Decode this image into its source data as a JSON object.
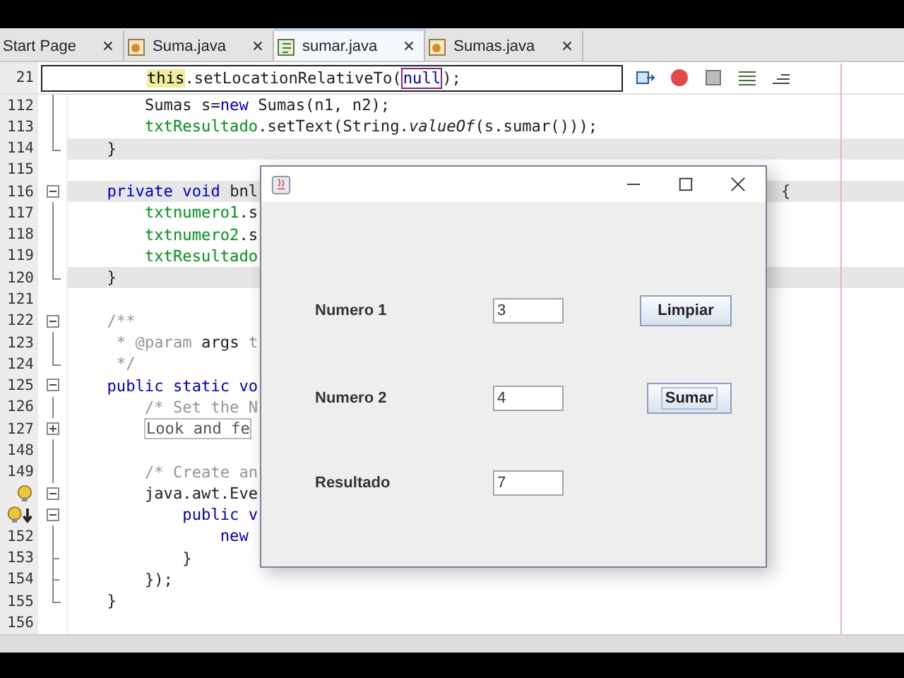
{
  "tabs": [
    {
      "label": "Start Page",
      "kind": "plain",
      "selected": false
    },
    {
      "label": "Suma.java",
      "kind": "java",
      "selected": false
    },
    {
      "label": "sumar.java",
      "kind": "form",
      "selected": true
    },
    {
      "label": "Sumas.java",
      "kind": "java",
      "selected": false
    }
  ],
  "sticky_line": {
    "number": "21",
    "tokens": [
      {
        "text": "this",
        "kind": "highlight"
      },
      {
        "text": ".setLocationRelativeTo(",
        "kind": "plain"
      },
      {
        "text": "null",
        "kind": "boxed"
      },
      {
        "text": ");",
        "kind": "plain"
      }
    ]
  },
  "lines": [
    {
      "number": "112",
      "kind": "body",
      "highlighted": false,
      "tokens": [
        {
          "text": "        Sumas s=",
          "kind": "plain"
        },
        {
          "text": "new",
          "kind": "keyword"
        },
        {
          "text": " Sumas(n1, n2);",
          "kind": "plain"
        }
      ]
    },
    {
      "number": "113",
      "kind": "body",
      "highlighted": false,
      "tokens": [
        {
          "text": "        txtResultado",
          "kind": "field"
        },
        {
          "text": ".setText(String.",
          "kind": "plain"
        },
        {
          "text": "valueOf",
          "kind": "italic"
        },
        {
          "text": "(s.sumar()));",
          "kind": "plain"
        }
      ]
    },
    {
      "number": "114",
      "kind": "end",
      "highlighted": true,
      "tokens": [
        {
          "text": "    }",
          "kind": "plain"
        }
      ]
    },
    {
      "number": "115",
      "kind": "plain",
      "highlighted": false
    },
    {
      "number": "116",
      "kind": "start",
      "highlighted": true,
      "tokens": [
        {
          "text": "    private void",
          "kind": "keyword"
        },
        {
          "text": " bnl",
          "kind": "plain"
        }
      ],
      "tail": "{"
    },
    {
      "number": "117",
      "kind": "body",
      "highlighted": false,
      "tokens": [
        {
          "text": "        txtnumero1",
          "kind": "field"
        },
        {
          "text": ".s",
          "kind": "plain"
        }
      ]
    },
    {
      "number": "118",
      "kind": "body",
      "highlighted": false,
      "tokens": [
        {
          "text": "        txtnumero2",
          "kind": "field"
        },
        {
          "text": ".s",
          "kind": "plain"
        }
      ]
    },
    {
      "number": "119",
      "kind": "body",
      "highlighted": false,
      "tokens": [
        {
          "text": "        txtResultado",
          "kind": "field"
        }
      ]
    },
    {
      "number": "120",
      "kind": "end",
      "highlighted": true,
      "tokens": [
        {
          "text": "    }",
          "kind": "plain"
        }
      ]
    },
    {
      "number": "121",
      "kind": "plain",
      "highlighted": false
    },
    {
      "number": "122",
      "kind": "start",
      "highlighted": false,
      "tokens": [
        {
          "text": "    /**",
          "kind": "comment"
        }
      ]
    },
    {
      "number": "123",
      "kind": "body",
      "highlighted": false,
      "tokens": [
        {
          "text": "     * @param ",
          "kind": "comment"
        },
        {
          "text": "args",
          "kind": "plain"
        },
        {
          "text": " t",
          "kind": "comment"
        }
      ]
    },
    {
      "number": "124",
      "kind": "end",
      "highlighted": false,
      "tokens": [
        {
          "text": "     */",
          "kind": "comment"
        }
      ]
    },
    {
      "number": "125",
      "kind": "start",
      "highlighted": false,
      "tokens": [
        {
          "text": "    public static vo",
          "kind": "keyword"
        }
      ]
    },
    {
      "number": "126",
      "kind": "body",
      "highlighted": false,
      "tokens": [
        {
          "text": "        /* Set the N",
          "kind": "comment"
        }
      ]
    },
    {
      "number": "127",
      "kind": "collapsed",
      "highlighted": false,
      "tokens": [
        {
          "text": "        Look and fe",
          "kind": "folded"
        }
      ]
    },
    {
      "number": "148",
      "kind": "body",
      "highlighted": false
    },
    {
      "number": "149",
      "kind": "body",
      "highlighted": false,
      "tokens": [
        {
          "text": "        /* Create an",
          "kind": "comment"
        }
      ]
    },
    {
      "kind": "bulb",
      "highlighted": false,
      "tokens": [
        {
          "text": "        java.awt.Eve",
          "kind": "plain"
        }
      ]
    },
    {
      "kind": "bulb-arrow",
      "highlighted": false,
      "tokens": [
        {
          "text": "            public v",
          "kind": "keyword"
        }
      ]
    },
    {
      "number": "152",
      "kind": "body",
      "highlighted": false,
      "tokens": [
        {
          "text": "                new",
          "kind": "keyword"
        }
      ]
    },
    {
      "number": "153",
      "kind": "tick",
      "highlighted": false,
      "tokens": [
        {
          "text": "            }",
          "kind": "plain"
        }
      ]
    },
    {
      "number": "154",
      "kind": "tick",
      "highlighted": false,
      "tokens": [
        {
          "text": "        });",
          "kind": "plain"
        }
      ]
    },
    {
      "number": "155",
      "kind": "end",
      "highlighted": false,
      "tokens": [
        {
          "text": "    }",
          "kind": "plain"
        }
      ]
    },
    {
      "number": "156",
      "kind": "plain",
      "highlighted": false
    }
  ],
  "dialog": {
    "rows": [
      {
        "label": "Numero 1",
        "value": "3",
        "button": {
          "label": "Limpiar",
          "focused": false
        }
      },
      {
        "label": "Numero 2",
        "value": "4",
        "button": {
          "label": "Sumar",
          "focused": true
        }
      },
      {
        "label": "Resultado",
        "value": "7"
      }
    ]
  }
}
